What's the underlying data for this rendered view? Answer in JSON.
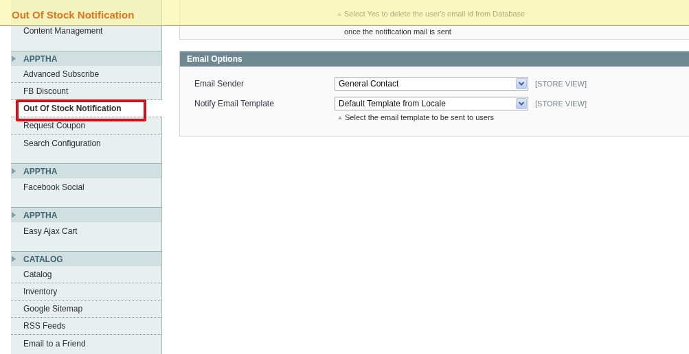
{
  "header": {
    "title": "Out Of Stock Notification"
  },
  "sidebar": {
    "groups": [
      {
        "items": [
          {
            "label": "Content Management",
            "selected": false,
            "highlighted": false
          }
        ]
      },
      {
        "title": "APPTHA",
        "items": [
          {
            "label": "Advanced Subscribe",
            "selected": false,
            "highlighted": false
          },
          {
            "label": "FB Discount",
            "selected": false,
            "highlighted": false
          },
          {
            "label": "Out Of Stock Notification",
            "selected": true,
            "highlighted": true
          },
          {
            "label": "Request Coupon",
            "selected": false,
            "highlighted": false
          },
          {
            "label": "Search Configuration",
            "selected": false,
            "highlighted": false
          }
        ]
      },
      {
        "title": "APPTHA",
        "items": [
          {
            "label": "Facebook Social",
            "selected": false,
            "highlighted": false
          }
        ]
      },
      {
        "title": "APPTHA",
        "items": [
          {
            "label": "Easy Ajax Cart",
            "selected": false,
            "highlighted": false
          }
        ]
      },
      {
        "title": "CATALOG",
        "items": [
          {
            "label": "Catalog",
            "selected": false,
            "highlighted": false
          },
          {
            "label": "Inventory",
            "selected": false,
            "highlighted": false
          },
          {
            "label": "Google Sitemap",
            "selected": false,
            "highlighted": false
          },
          {
            "label": "RSS Feeds",
            "selected": false,
            "highlighted": false
          },
          {
            "label": "Email to a Friend",
            "selected": false,
            "highlighted": false
          }
        ]
      }
    ]
  },
  "content": {
    "previous_section": {
      "note": "Select Yes to delete the user's email id from Database once the notification mail is sent"
    },
    "section": {
      "title": "Email Options",
      "fields": [
        {
          "label": "Email Sender",
          "value": "General Contact",
          "scope": "[STORE VIEW]"
        },
        {
          "label": "Notify Email Template",
          "value": "Default Template from Locale",
          "scope": "[STORE VIEW]",
          "note": "Select the email template to be sent to users"
        }
      ]
    }
  }
}
